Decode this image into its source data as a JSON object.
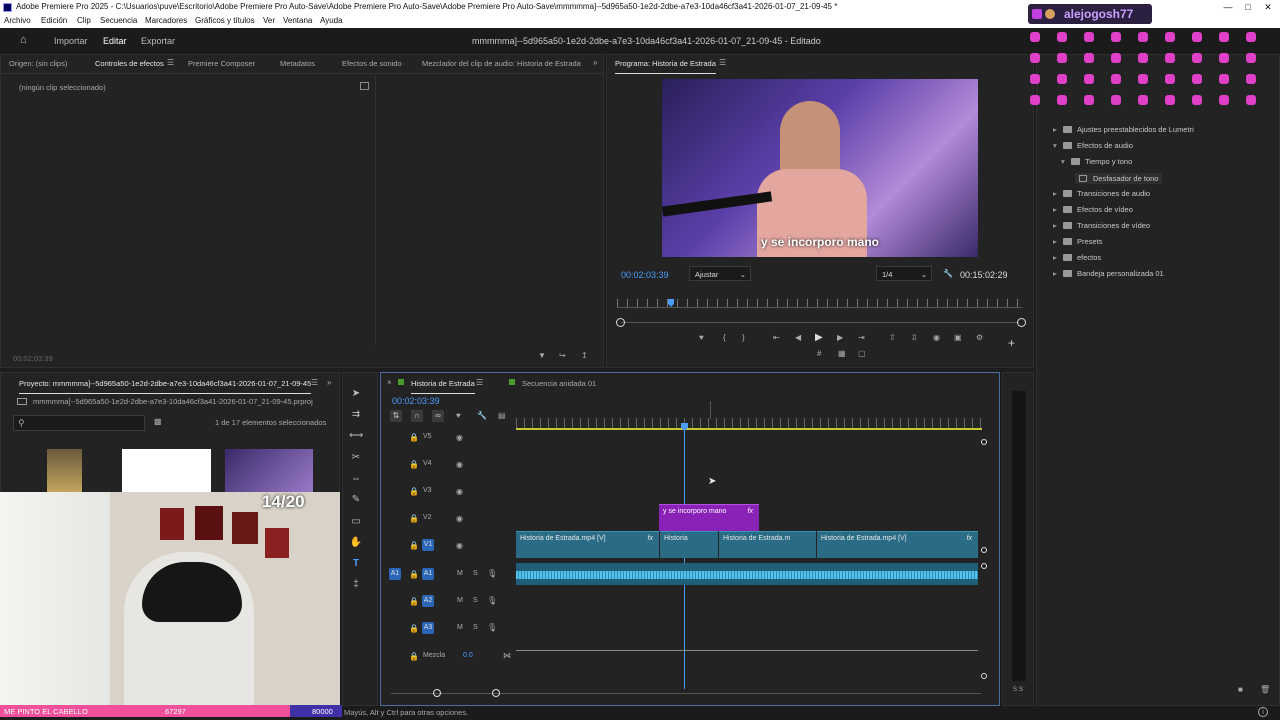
{
  "window": {
    "title": "Adobe Premiere Pro 2025 - C:\\Usuarios\\puve\\Escritorio\\Adobe Premiere Pro Auto-Save\\Adobe Premiere Pro Auto-Save\\Adobe Premiere Pro Auto-Save\\mmmmma]--5d965a50-1e2d-2dbe-a7e3-10da46cf3a41-2026-01-07_21-09-45 *"
  },
  "menu": [
    "Archivo",
    "Edición",
    "Clip",
    "Secuencia",
    "Marcadores",
    "Gráficos y títulos",
    "Ver",
    "Ventana",
    "Ayuda"
  ],
  "workspace": {
    "tabs": [
      "Importar",
      "Editar",
      "Exportar"
    ],
    "active": "Editar",
    "doc_title": "mmmmma]--5d965a50-1e2d-2dbe-a7e3-10da46cf3a41-2026-01-07_21-09-45 - Editado"
  },
  "source_panel": {
    "origin_tab": "Origen: (sin clips)",
    "tabs": [
      "Controles de efectos",
      "Premiere Composer",
      "Metadatos",
      "Efectos de sonido",
      "Mezclador del clip de audio: Historia de Estrada"
    ],
    "empty_text": "(ningún clip seleccionado)",
    "timecode": "00:02:03:39"
  },
  "program_monitor": {
    "title": "Programa: Historia de Estrada",
    "subtitle": "y se incorporo mano",
    "current_time": "00:02:03:39",
    "fit": "Ajustar",
    "resolution": "1/4",
    "duration": "00:15:02:29"
  },
  "project": {
    "title": "Proyecto: mmmmma]--5d965a50-1e2d-2dbe-a7e3-10da46cf3a41-2026-01-07_21-09-45",
    "file": "mmmmma]--5d965a50-1e2d-2dbe-a7e3-10da46cf3a41-2026-01-07_21-09-45.prproj",
    "selection": "1 de 17 elementos seleccionados"
  },
  "timeline": {
    "tabs": [
      "Historia de Estrada",
      "Secuencia anidada 01"
    ],
    "timecode": "00:02:03:39",
    "video_tracks": [
      "V5",
      "V4",
      "V3",
      "V2",
      "V1"
    ],
    "audio_tracks": [
      "A1",
      "A2",
      "A3"
    ],
    "source_patch_v": "V1",
    "source_patch_a": "A1",
    "mix_label": "Mezcla",
    "mix_value": "0.0",
    "clips": {
      "v2": "y se incorporo mano",
      "v1_a": "Historia de Estrada.mp4 [V]",
      "v1_b": "Historia",
      "v1_c": "Historia de Estrada.m",
      "v1_d": "Historia de Estrada.mp4 [V]"
    },
    "fx": "fx",
    "track_m": "M",
    "track_s": "S"
  },
  "effects": {
    "items": [
      {
        "label": "Ajustes preestablecidos de Lumetri",
        "level": 0,
        "expanded": false
      },
      {
        "label": "Efectos de audio",
        "level": 0,
        "expanded": true
      },
      {
        "label": "Tiempo y tono",
        "level": 1,
        "expanded": true
      },
      {
        "label": "Desfasador de tono",
        "level": 2,
        "expanded": false
      },
      {
        "label": "Transiciones de audio",
        "level": 0,
        "expanded": false
      },
      {
        "label": "Efectos de vídeo",
        "level": 0,
        "expanded": false
      },
      {
        "label": "Transiciones de vídeo",
        "level": 0,
        "expanded": false
      },
      {
        "label": "Presets",
        "level": 0,
        "expanded": false
      },
      {
        "label": "efectos",
        "level": 0,
        "expanded": false
      },
      {
        "label": "Bandeja personalizada 01",
        "level": 0,
        "expanded": false
      }
    ]
  },
  "overlay": {
    "username": "alejogosh77",
    "counter": "14/20",
    "banner_text": "ME PINTO EL CABELLO",
    "banner_count": "67297",
    "banner_goal": "80000"
  },
  "status_bar": "Mayús, Alt y Ctrl para otras opciones.",
  "colors": {
    "accent": "#4b9cff",
    "clip_video": "#2a6b86",
    "clip_graphic": "#8a22b8",
    "banner": "#f0509a"
  }
}
